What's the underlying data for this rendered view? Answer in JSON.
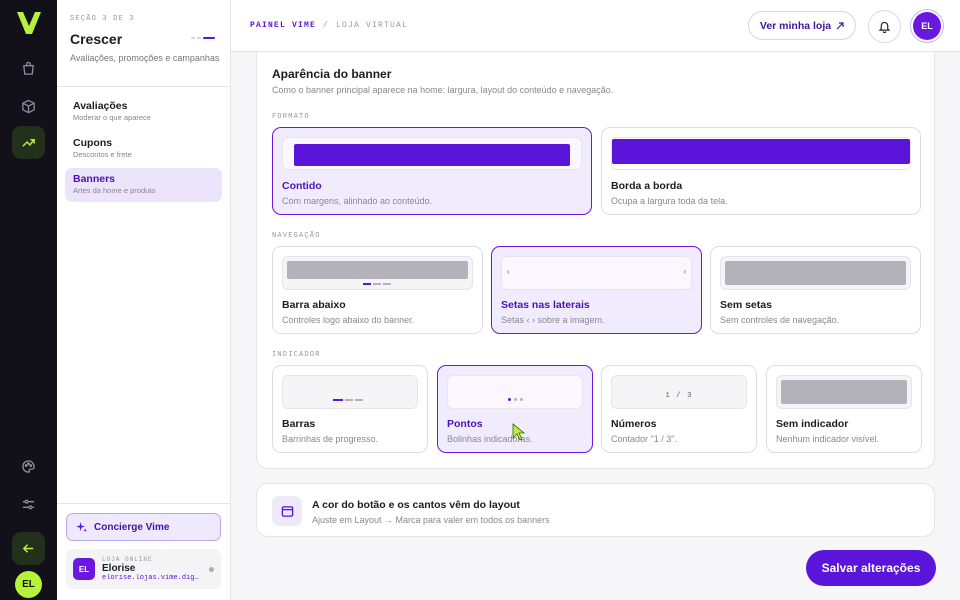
{
  "rail": {
    "logo": "V",
    "items": [
      {
        "icon": "shopping-bag-icon",
        "active": false
      },
      {
        "icon": "box-icon",
        "active": false
      },
      {
        "icon": "trending-up-icon",
        "active": true
      }
    ],
    "bottom_icons": [
      "palette-icon",
      "sliders-icon"
    ],
    "back_icon": "arrow-left-icon",
    "avatar": "EL"
  },
  "sidebar": {
    "eyebrow": "SEÇÃO 3 DE 3",
    "title": "Crescer",
    "description": "Avaliações, promoções e campanhas",
    "items": [
      {
        "label": "Avaliações",
        "sub": "Moderar o que aparece"
      },
      {
        "label": "Cupons",
        "sub": "Descontos e frete"
      },
      {
        "label": "Banners",
        "sub": "Artes da home e produto"
      }
    ],
    "concierge": "Concierge Vime",
    "store": {
      "eyebrow": "LOJA ONLINE",
      "avatar": "EL",
      "name": "Elorise",
      "url": "elorise.lojas.vime.digital"
    }
  },
  "topbar": {
    "breadcrumb": [
      "PAINEL VIME",
      "/",
      "LOJA VIRTUAL"
    ],
    "view_store": "Ver minha loja",
    "avatar": "EL"
  },
  "banner": {
    "title": "Aparência do banner",
    "subtitle": "Como o banner principal aparece na home: largura, layout do conteúdo e navegação.",
    "format": {
      "label": "FORMATO",
      "options": [
        {
          "label": "Contido",
          "sub": "Com margens, alinhado ao conteúdo.",
          "selected": true
        },
        {
          "label": "Borda a borda",
          "sub": "Ocupa a largura toda da tela.",
          "selected": false
        }
      ]
    },
    "navigation": {
      "label": "NAVEGAÇÃO",
      "options": [
        {
          "label": "Barra abaixo",
          "sub": "Controles logo abaixo do banner.",
          "selected": false
        },
        {
          "label": "Setas nas laterais",
          "sub": "Setas ‹ › sobre a imagem.",
          "selected": true
        },
        {
          "label": "Sem setas",
          "sub": "Sem controles de navegação.",
          "selected": false
        }
      ],
      "arrow_left": "‹",
      "arrow_right": "›"
    },
    "indicator": {
      "label": "INDICADOR",
      "options": [
        {
          "label": "Barras",
          "sub": "Barrinhas de progresso.",
          "selected": false
        },
        {
          "label": "Pontos",
          "sub": "Bolinhas indicadoras.",
          "selected": true
        },
        {
          "label": "Números",
          "sub": "Contador \"1 / 3\".",
          "selected": false
        },
        {
          "label": "Sem indicador",
          "sub": "Nenhum indicador visível.",
          "selected": false
        }
      ],
      "counter": "1 / 3"
    }
  },
  "info": {
    "title": "A cor do botão e os cantos vêm do layout",
    "text": "Ajuste em Layout → Marca para valer em todos os banners"
  },
  "save_button": "Salvar alterações",
  "colors": {
    "accent": "#5b14d9",
    "lime": "#b6f23a",
    "rail": "#121018"
  }
}
